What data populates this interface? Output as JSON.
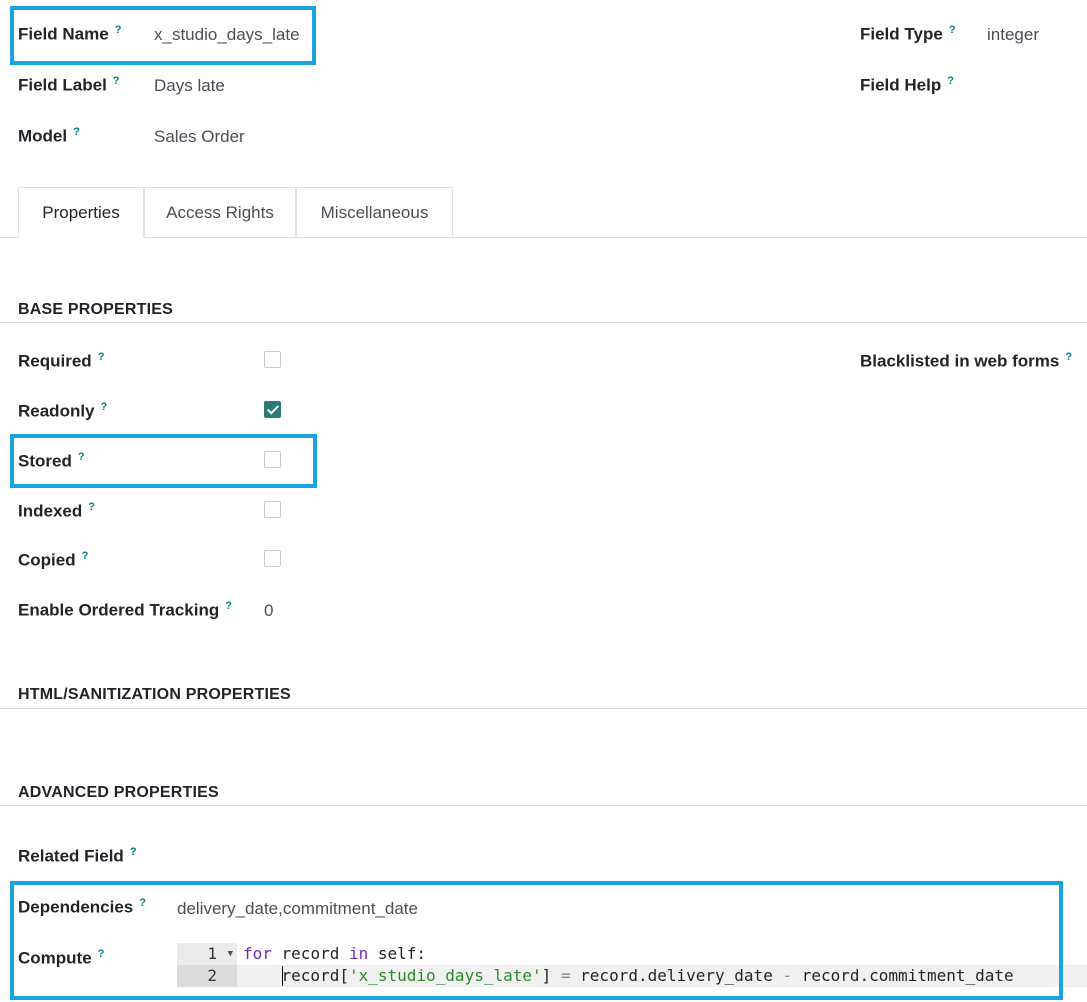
{
  "header": {
    "field_name": {
      "label": "Field Name",
      "value": "x_studio_days_late"
    },
    "field_type": {
      "label": "Field Type",
      "value": "integer"
    },
    "field_label": {
      "label": "Field Label",
      "value": "Days late"
    },
    "field_help": {
      "label": "Field Help"
    },
    "model": {
      "label": "Model",
      "value": "Sales Order"
    },
    "help_marker": "?"
  },
  "tabs": [
    {
      "label": "Properties",
      "active": true
    },
    {
      "label": "Access Rights",
      "active": false
    },
    {
      "label": "Miscellaneous",
      "active": false
    }
  ],
  "base_properties": {
    "title": "BASE PROPERTIES",
    "required": {
      "label": "Required",
      "checked": false
    },
    "readonly": {
      "label": "Readonly",
      "checked": true
    },
    "stored": {
      "label": "Stored",
      "checked": false
    },
    "indexed": {
      "label": "Indexed",
      "checked": false
    },
    "copied": {
      "label": "Copied",
      "checked": false
    },
    "tracking": {
      "label": "Enable Ordered Tracking",
      "value": "0"
    },
    "blacklisted": {
      "label": "Blacklisted in web forms"
    }
  },
  "html_properties": {
    "title": "HTML/SANITIZATION PROPERTIES"
  },
  "advanced_properties": {
    "title": "ADVANCED PROPERTIES",
    "related_field": {
      "label": "Related Field"
    },
    "dependencies": {
      "label": "Dependencies",
      "value": "delivery_date,commitment_date"
    },
    "compute": {
      "label": "Compute",
      "lines": [
        {
          "number": "1",
          "kw1": "for",
          "t1": " record ",
          "kw2": "in",
          "t2": " self:"
        },
        {
          "number": "2",
          "t1": "    record[",
          "str": "'x_studio_days_late'",
          "t2": "] ",
          "op1": "=",
          "t3": " record.delivery_date ",
          "op2": "-",
          "t4": " record.commitment_date"
        }
      ]
    }
  },
  "colors": {
    "highlight": "#1aa3df",
    "checkbox_checked": "#2b7a78",
    "help_marker": "#017e84"
  }
}
